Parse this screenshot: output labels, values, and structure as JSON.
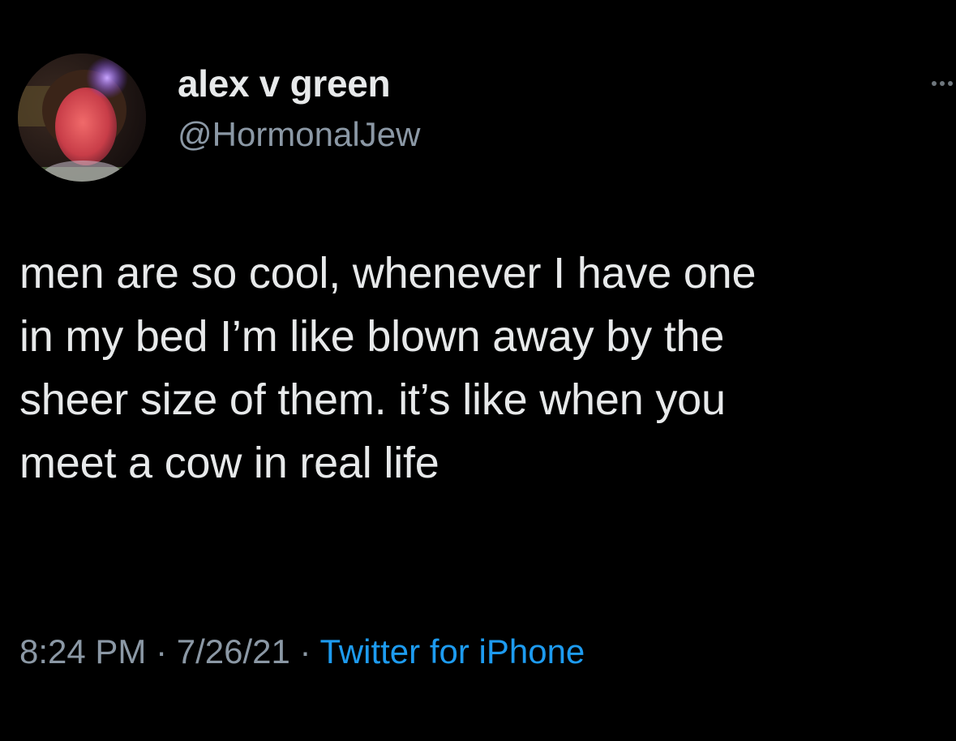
{
  "author": {
    "display_name": "alex v green",
    "handle": "@HormonalJew"
  },
  "tweet": {
    "lines": [
      "men are so cool, whenever I have one",
      "in my bed I’m like blown away by the",
      "sheer size of them. it’s like when you",
      "meet a cow in real life"
    ]
  },
  "meta": {
    "time": "8:24 PM",
    "sep1": " · ",
    "date": "7/26/21",
    "sep2": " · ",
    "source": "Twitter for iPhone"
  },
  "icons": {
    "more": "more-options-icon"
  },
  "colors": {
    "background": "#000000",
    "primary_text": "#e7e9ea",
    "secondary_text": "#8b98a5",
    "link": "#1d9bf0"
  }
}
